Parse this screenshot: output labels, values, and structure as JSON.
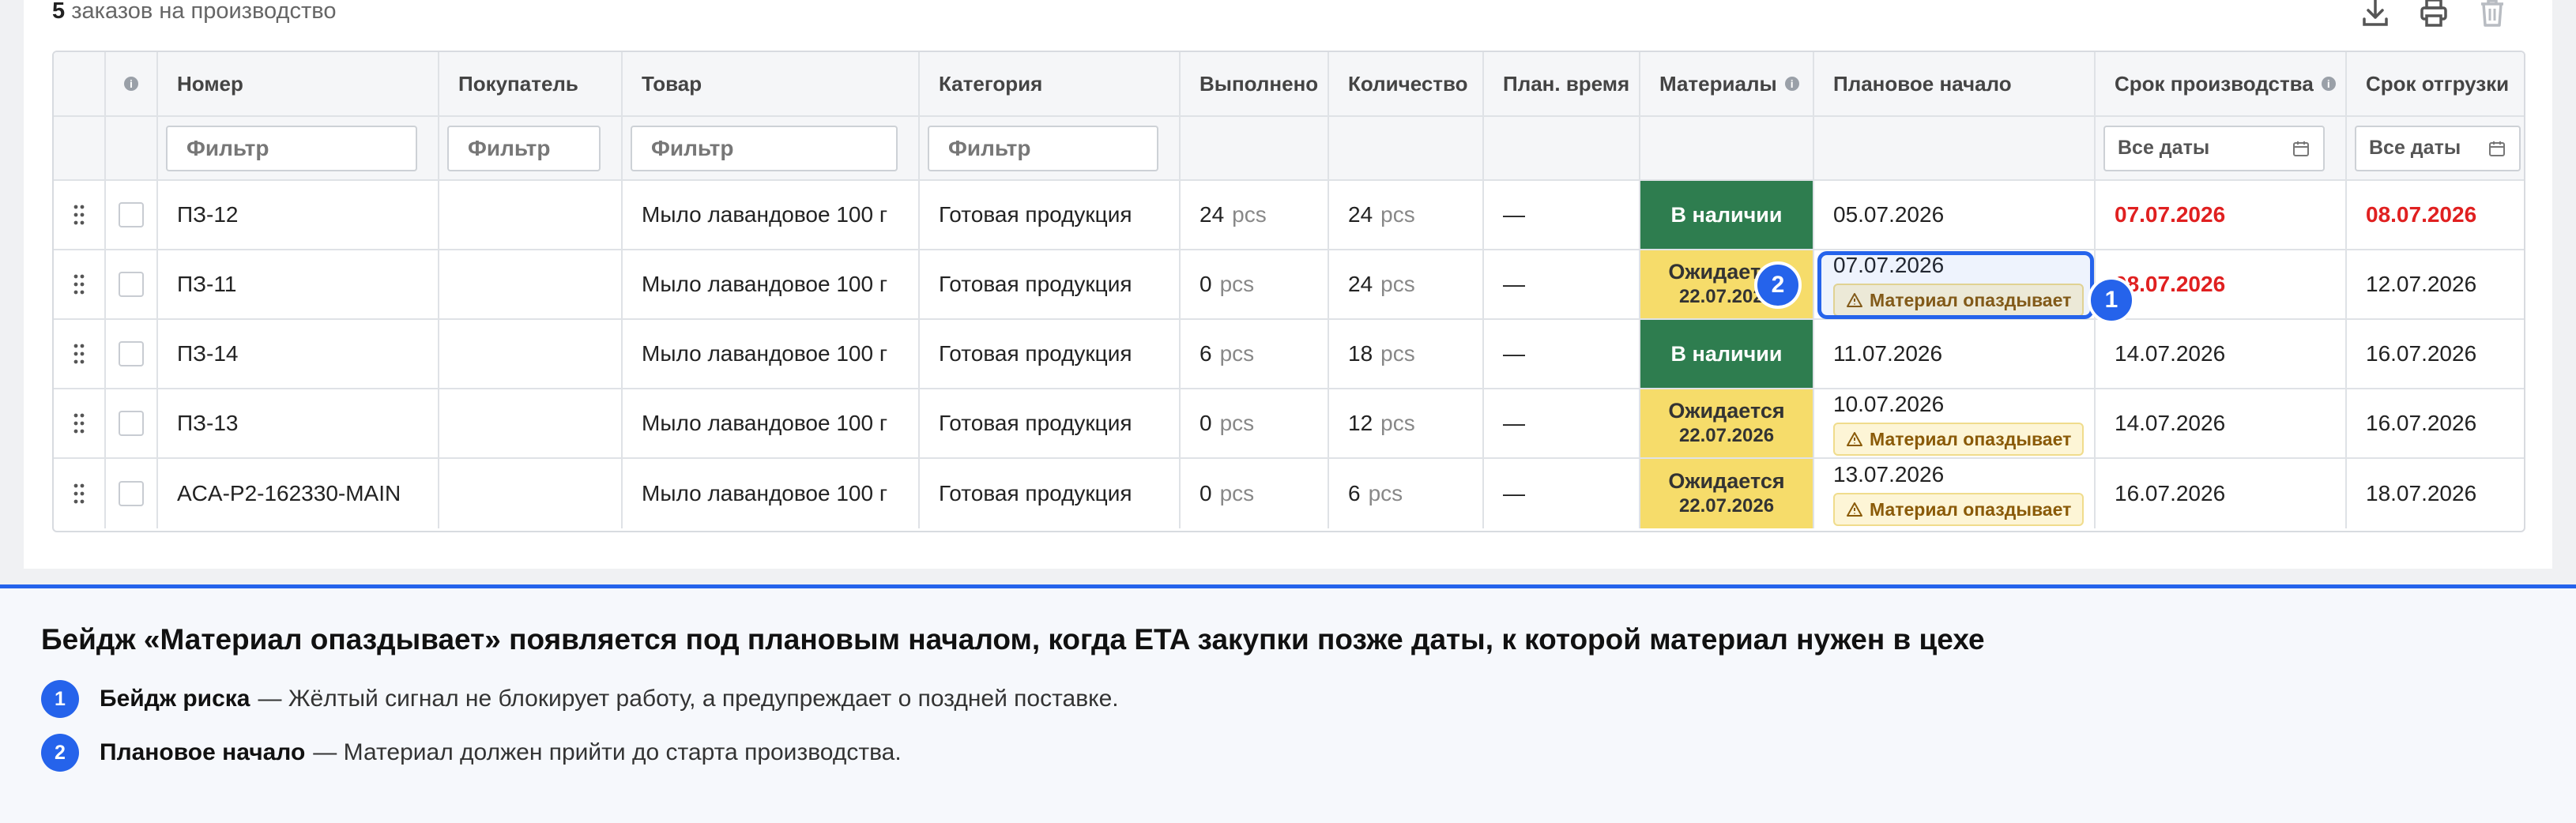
{
  "summary": {
    "count": "5",
    "text": "заказов на производство"
  },
  "toolbar": {
    "download_icon": "download-icon",
    "print_icon": "printer-icon",
    "delete_icon": "trash-icon"
  },
  "columns": [
    "",
    "",
    "Номер",
    "Покупатель",
    "Товар",
    "Категория",
    "Выполнено",
    "Количество",
    "План. время",
    "Материалы",
    "Плановое начало",
    "Срок производства",
    "Срок отгрузки"
  ],
  "filters": {
    "number": "Фильтр",
    "buyer": "Фильтр",
    "product": "Фильтр",
    "category": "Фильтр",
    "all_dates_1": "Все даты",
    "all_dates_2": "Все даты"
  },
  "rows": [
    {
      "number": "ПЗ-12",
      "buyer": "",
      "product": "Мыло лавандовое 100 г",
      "category": "Готовая продукция",
      "done": "24",
      "qty": "24",
      "unit": "pcs",
      "time": "—",
      "material": "В наличии",
      "material_date": "",
      "plan_start": "05.07.2026",
      "badge": "",
      "prod_deadline": "07.07.2026",
      "ship_deadline": "08.07.2026"
    },
    {
      "number": "ПЗ-11",
      "buyer": "",
      "product": "Мыло лавандовое 100 г",
      "category": "Готовая продукция",
      "done": "0",
      "qty": "24",
      "unit": "pcs",
      "time": "—",
      "material": "Ожидается",
      "material_date": "22.07.2026",
      "plan_start": "07.07.2026",
      "badge": "Материал опаздывает",
      "prod_deadline": "08.07.2026",
      "ship_deadline": "12.07.2026"
    },
    {
      "number": "ПЗ-14",
      "buyer": "",
      "product": "Мыло лавандовое 100 г",
      "category": "Готовая продукция",
      "done": "6",
      "qty": "18",
      "unit": "pcs",
      "time": "—",
      "material": "В наличии",
      "material_date": "",
      "plan_start": "11.07.2026",
      "badge": "",
      "prod_deadline": "14.07.2026",
      "ship_deadline": "16.07.2026"
    },
    {
      "number": "ПЗ-13",
      "buyer": "",
      "product": "Мыло лавандовое 100 г",
      "category": "Готовая продукция",
      "done": "0",
      "qty": "12",
      "unit": "pcs",
      "time": "—",
      "material": "Ожидается",
      "material_date": "22.07.2026",
      "plan_start": "10.07.2026",
      "badge": "Материал опаздывает",
      "prod_deadline": "14.07.2026",
      "ship_deadline": "16.07.2026"
    },
    {
      "number": "ACA-P2-162330-MAIN",
      "buyer": "",
      "product": "Мыло лавандовое 100 г",
      "category": "Готовая продукция",
      "done": "0",
      "qty": "6",
      "unit": "pcs",
      "time": "—",
      "material": "Ожидается",
      "material_date": "22.07.2026",
      "plan_start": "13.07.2026",
      "badge": "Материал опаздывает",
      "prod_deadline": "16.07.2026",
      "ship_deadline": "18.07.2026"
    }
  ],
  "markers": {
    "one": "1",
    "two": "2"
  },
  "panel": {
    "title": "Бейдж «Материал опаздывает» появляется под плановым началом, когда ETA закупки позже даты, к которой материал нужен в цехе",
    "notes": [
      {
        "num": "1",
        "label": "Бейдж риска",
        "text": "— Жёлтый сигнал не блокирует работу, а предупреждает о поздней поставке."
      },
      {
        "num": "2",
        "label": "Плановое начало",
        "text": "— Материал должен прийти до старта производства."
      }
    ]
  },
  "colors": {
    "accent": "#2563eb",
    "in_stock": "#2e7d4f",
    "waiting": "#f6dc6a",
    "overdue": "#e02020"
  }
}
